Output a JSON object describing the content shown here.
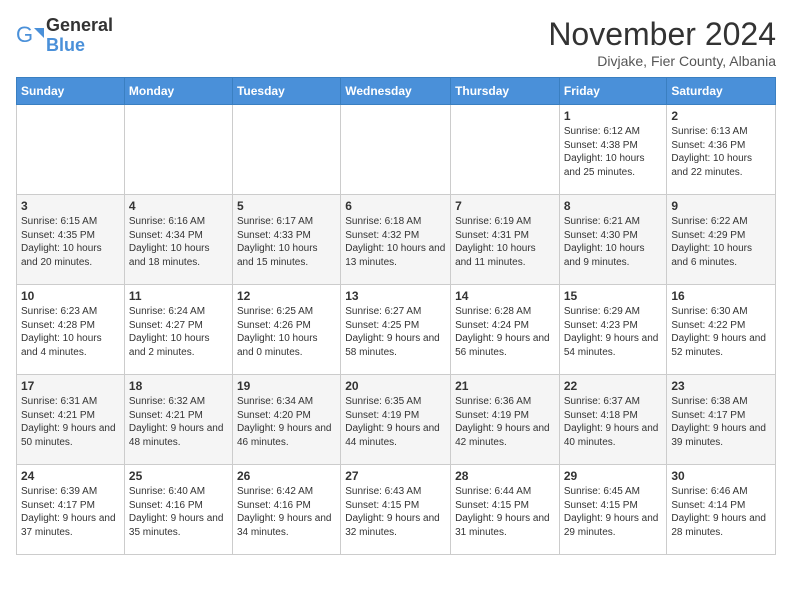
{
  "header": {
    "logo_general": "General",
    "logo_blue": "Blue",
    "month_title": "November 2024",
    "subtitle": "Divjake, Fier County, Albania"
  },
  "weekdays": [
    "Sunday",
    "Monday",
    "Tuesday",
    "Wednesday",
    "Thursday",
    "Friday",
    "Saturday"
  ],
  "weeks": [
    [
      {
        "day": "",
        "info": ""
      },
      {
        "day": "",
        "info": ""
      },
      {
        "day": "",
        "info": ""
      },
      {
        "day": "",
        "info": ""
      },
      {
        "day": "",
        "info": ""
      },
      {
        "day": "1",
        "info": "Sunrise: 6:12 AM\nSunset: 4:38 PM\nDaylight: 10 hours and 25 minutes."
      },
      {
        "day": "2",
        "info": "Sunrise: 6:13 AM\nSunset: 4:36 PM\nDaylight: 10 hours and 22 minutes."
      }
    ],
    [
      {
        "day": "3",
        "info": "Sunrise: 6:15 AM\nSunset: 4:35 PM\nDaylight: 10 hours and 20 minutes."
      },
      {
        "day": "4",
        "info": "Sunrise: 6:16 AM\nSunset: 4:34 PM\nDaylight: 10 hours and 18 minutes."
      },
      {
        "day": "5",
        "info": "Sunrise: 6:17 AM\nSunset: 4:33 PM\nDaylight: 10 hours and 15 minutes."
      },
      {
        "day": "6",
        "info": "Sunrise: 6:18 AM\nSunset: 4:32 PM\nDaylight: 10 hours and 13 minutes."
      },
      {
        "day": "7",
        "info": "Sunrise: 6:19 AM\nSunset: 4:31 PM\nDaylight: 10 hours and 11 minutes."
      },
      {
        "day": "8",
        "info": "Sunrise: 6:21 AM\nSunset: 4:30 PM\nDaylight: 10 hours and 9 minutes."
      },
      {
        "day": "9",
        "info": "Sunrise: 6:22 AM\nSunset: 4:29 PM\nDaylight: 10 hours and 6 minutes."
      }
    ],
    [
      {
        "day": "10",
        "info": "Sunrise: 6:23 AM\nSunset: 4:28 PM\nDaylight: 10 hours and 4 minutes."
      },
      {
        "day": "11",
        "info": "Sunrise: 6:24 AM\nSunset: 4:27 PM\nDaylight: 10 hours and 2 minutes."
      },
      {
        "day": "12",
        "info": "Sunrise: 6:25 AM\nSunset: 4:26 PM\nDaylight: 10 hours and 0 minutes."
      },
      {
        "day": "13",
        "info": "Sunrise: 6:27 AM\nSunset: 4:25 PM\nDaylight: 9 hours and 58 minutes."
      },
      {
        "day": "14",
        "info": "Sunrise: 6:28 AM\nSunset: 4:24 PM\nDaylight: 9 hours and 56 minutes."
      },
      {
        "day": "15",
        "info": "Sunrise: 6:29 AM\nSunset: 4:23 PM\nDaylight: 9 hours and 54 minutes."
      },
      {
        "day": "16",
        "info": "Sunrise: 6:30 AM\nSunset: 4:22 PM\nDaylight: 9 hours and 52 minutes."
      }
    ],
    [
      {
        "day": "17",
        "info": "Sunrise: 6:31 AM\nSunset: 4:21 PM\nDaylight: 9 hours and 50 minutes."
      },
      {
        "day": "18",
        "info": "Sunrise: 6:32 AM\nSunset: 4:21 PM\nDaylight: 9 hours and 48 minutes."
      },
      {
        "day": "19",
        "info": "Sunrise: 6:34 AM\nSunset: 4:20 PM\nDaylight: 9 hours and 46 minutes."
      },
      {
        "day": "20",
        "info": "Sunrise: 6:35 AM\nSunset: 4:19 PM\nDaylight: 9 hours and 44 minutes."
      },
      {
        "day": "21",
        "info": "Sunrise: 6:36 AM\nSunset: 4:19 PM\nDaylight: 9 hours and 42 minutes."
      },
      {
        "day": "22",
        "info": "Sunrise: 6:37 AM\nSunset: 4:18 PM\nDaylight: 9 hours and 40 minutes."
      },
      {
        "day": "23",
        "info": "Sunrise: 6:38 AM\nSunset: 4:17 PM\nDaylight: 9 hours and 39 minutes."
      }
    ],
    [
      {
        "day": "24",
        "info": "Sunrise: 6:39 AM\nSunset: 4:17 PM\nDaylight: 9 hours and 37 minutes."
      },
      {
        "day": "25",
        "info": "Sunrise: 6:40 AM\nSunset: 4:16 PM\nDaylight: 9 hours and 35 minutes."
      },
      {
        "day": "26",
        "info": "Sunrise: 6:42 AM\nSunset: 4:16 PM\nDaylight: 9 hours and 34 minutes."
      },
      {
        "day": "27",
        "info": "Sunrise: 6:43 AM\nSunset: 4:15 PM\nDaylight: 9 hours and 32 minutes."
      },
      {
        "day": "28",
        "info": "Sunrise: 6:44 AM\nSunset: 4:15 PM\nDaylight: 9 hours and 31 minutes."
      },
      {
        "day": "29",
        "info": "Sunrise: 6:45 AM\nSunset: 4:15 PM\nDaylight: 9 hours and 29 minutes."
      },
      {
        "day": "30",
        "info": "Sunrise: 6:46 AM\nSunset: 4:14 PM\nDaylight: 9 hours and 28 minutes."
      }
    ]
  ]
}
